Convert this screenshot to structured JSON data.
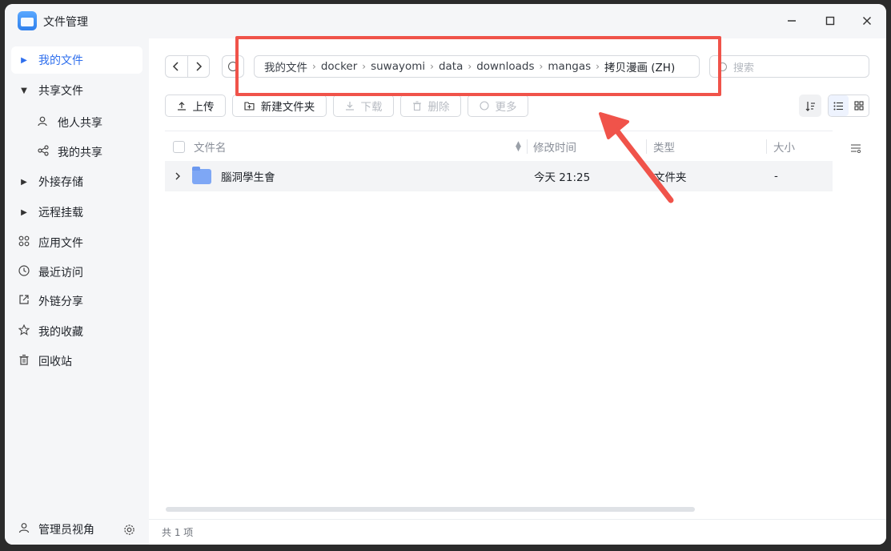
{
  "app": {
    "title": "文件管理"
  },
  "window_controls": {
    "minimize": "—",
    "maximize": "☐",
    "close": "✕"
  },
  "sidebar": {
    "items": [
      {
        "label": "我的文件",
        "active": true,
        "expandable": true
      },
      {
        "label": "共享文件",
        "expandable": true,
        "expanded": true
      },
      {
        "label": "他人共享",
        "sub": true,
        "icon": "users-icon"
      },
      {
        "label": "我的共享",
        "sub": true,
        "icon": "share-icon"
      },
      {
        "label": "外接存储",
        "expandable": true
      },
      {
        "label": "远程挂载",
        "expandable": true
      },
      {
        "label": "应用文件",
        "icon": "apps-icon"
      },
      {
        "label": "最近访问",
        "icon": "clock-icon"
      },
      {
        "label": "外链分享",
        "icon": "external-share-icon"
      },
      {
        "label": "我的收藏",
        "icon": "star-icon"
      },
      {
        "label": "回收站",
        "icon": "trash-icon"
      }
    ],
    "footer": {
      "label": "管理员视角",
      "icon": "admin-icon",
      "settings_icon": "gear-icon"
    }
  },
  "breadcrumb": {
    "segments": [
      "我的文件",
      "docker",
      "suwayomi",
      "data",
      "downloads",
      "mangas",
      "拷贝漫画 (ZH)"
    ]
  },
  "search": {
    "placeholder": "搜索"
  },
  "toolbar": {
    "upload": "上传",
    "new_folder": "新建文件夹",
    "download": "下载",
    "delete": "删除",
    "more": "更多"
  },
  "table": {
    "columns": [
      "文件名",
      "修改时间",
      "类型",
      "大小"
    ],
    "rows": [
      {
        "name": "腦洞學生會",
        "modified": "今天 21:25",
        "type": "文件夹",
        "size": "-"
      }
    ]
  },
  "status": {
    "count_text": "共 1 项"
  },
  "annotation": {
    "color": "#f0534a"
  }
}
